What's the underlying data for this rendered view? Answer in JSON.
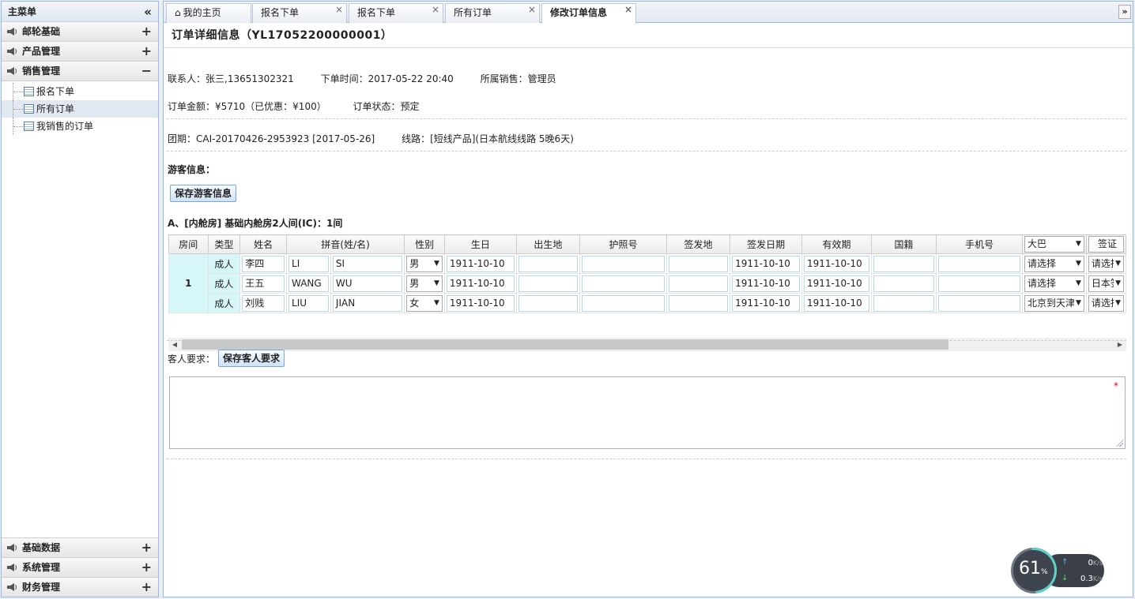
{
  "sidebar": {
    "title": "主菜单",
    "groups": [
      {
        "label": "邮轮基础"
      },
      {
        "label": "产品管理"
      },
      {
        "label": "销售管理"
      }
    ],
    "items": [
      {
        "label": "报名下单"
      },
      {
        "label": "所有订单"
      },
      {
        "label": "我销售的订单"
      }
    ],
    "bottom_groups": [
      {
        "label": "基础数据"
      },
      {
        "label": "系统管理"
      },
      {
        "label": "财务管理"
      }
    ],
    "expand_symbol": "+",
    "collapse_symbol": "−",
    "collapse_all": "«"
  },
  "tabs": [
    {
      "label": "我的主页"
    },
    {
      "label": "报名下单"
    },
    {
      "label": "报名下单"
    },
    {
      "label": "所有订单"
    },
    {
      "label": "修改订单信息"
    }
  ],
  "page": {
    "title": "订单详细信息（YL17052200000001）",
    "contact": "联系人：张三,13651302321",
    "order_time": "下单时间：2017-05-22 20:40",
    "sales": "所属销售：管理员",
    "amount": "订单金额：¥5710（已优惠：¥100）",
    "status": "订单状态：预定",
    "group": "团期：CAI-20170426-2953923 [2017-05-26]",
    "route": "线路：[短线产品](日本航线线路 5晚6天)",
    "guest_info_label": "游客信息：",
    "save_guest_btn": "保存游客信息",
    "cabin_title": "A、[内舱房] 基础内舱房2人间(IC)：1间",
    "req_label": "客人要求：",
    "save_req_btn": "保存客人要求",
    "req_star": "*"
  },
  "table": {
    "headers": [
      "房间",
      "类型",
      "姓名",
      "拼音(姓/名)",
      "性别",
      "生日",
      "出生地",
      "护照号",
      "签发地",
      "签发日期",
      "有效期",
      "国籍",
      "手机号"
    ],
    "header_select": "大巴",
    "header_visa": "签证",
    "room": "1",
    "rows": [
      {
        "type": "成人",
        "name": "李四",
        "py1": "LI",
        "py2": "SI",
        "gender": "男",
        "birth": "1911-10-10",
        "issue": "1911-10-10",
        "expire": "1911-10-10",
        "bus": "请选择",
        "visa": "请选择"
      },
      {
        "type": "成人",
        "name": "王五",
        "py1": "WANG",
        "py2": "WU",
        "gender": "男",
        "birth": "1911-10-10",
        "issue": "1911-10-10",
        "expire": "1911-10-10",
        "bus": "请选择",
        "visa": "日本签"
      },
      {
        "type": "成人",
        "name": "刘贱",
        "py1": "LIU",
        "py2": "JIAN",
        "gender": "女",
        "birth": "1911-10-10",
        "issue": "1911-10-10",
        "expire": "1911-10-10",
        "bus": "北京到天津",
        "visa": "请选择"
      }
    ]
  },
  "widget": {
    "percent": "61",
    "percent_sign": "%",
    "up": "0",
    "down": "0.3",
    "unit": "K/s"
  }
}
